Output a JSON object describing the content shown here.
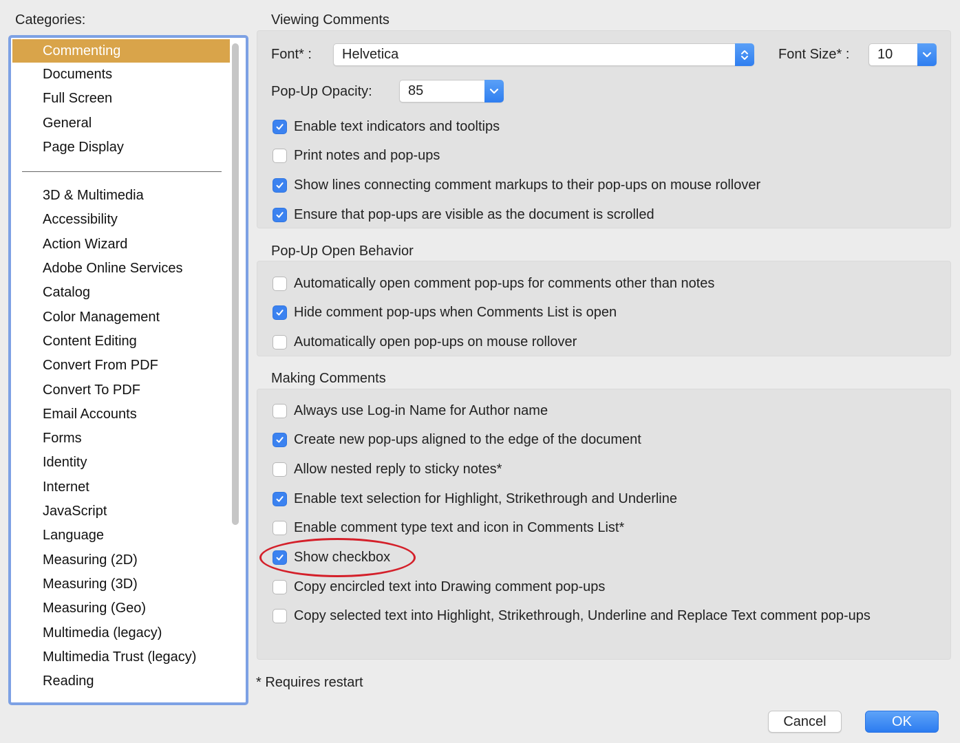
{
  "categories": {
    "title": "Categories:",
    "top_items": [
      {
        "label": "Commenting",
        "selected": true
      },
      {
        "label": "Documents"
      },
      {
        "label": "Full Screen"
      },
      {
        "label": "General"
      },
      {
        "label": "Page Display"
      }
    ],
    "items": [
      "3D & Multimedia",
      "Accessibility",
      "Action Wizard",
      "Adobe Online Services",
      "Catalog",
      "Color Management",
      "Content Editing",
      "Convert From PDF",
      "Convert To PDF",
      "Email Accounts",
      "Forms",
      "Identity",
      "Internet",
      "JavaScript",
      "Language",
      "Measuring (2D)",
      "Measuring (3D)",
      "Measuring (Geo)",
      "Multimedia (legacy)",
      "Multimedia Trust (legacy)",
      "Reading"
    ]
  },
  "viewing": {
    "title": "Viewing Comments",
    "font_label": "Font* :",
    "font_value": "Helvetica",
    "font_size_label": "Font Size* :",
    "font_size_value": "10",
    "opacity_label": "Pop-Up Opacity:",
    "opacity_value": "85",
    "options": [
      {
        "label": "Enable text indicators and tooltips",
        "checked": true
      },
      {
        "label": "Print notes and pop-ups",
        "checked": false
      },
      {
        "label": "Show lines connecting comment markups to their pop-ups on mouse rollover",
        "checked": true
      },
      {
        "label": "Ensure that pop-ups are visible as the document is scrolled",
        "checked": true
      }
    ]
  },
  "popup": {
    "title": "Pop-Up Open Behavior",
    "options": [
      {
        "label": "Automatically open comment pop-ups for comments other than notes",
        "checked": false
      },
      {
        "label": "Hide comment pop-ups when Comments List is open",
        "checked": true
      },
      {
        "label": "Automatically open pop-ups on mouse rollover",
        "checked": false
      }
    ]
  },
  "making": {
    "title": "Making Comments",
    "options": [
      {
        "label": "Always use Log-in Name for Author name",
        "checked": false
      },
      {
        "label": "Create new pop-ups aligned to the edge of the document",
        "checked": true
      },
      {
        "label": "Allow nested reply to sticky notes*",
        "checked": false
      },
      {
        "label": "Enable text selection for Highlight, Strikethrough and Underline",
        "checked": true
      },
      {
        "label": "Enable comment type text and icon in Comments List*",
        "checked": false
      },
      {
        "label": "Show checkbox",
        "checked": true
      },
      {
        "label": "Copy encircled text into Drawing comment pop-ups",
        "checked": false
      },
      {
        "label": "Copy selected text into Highlight, Strikethrough, Underline and Replace Text comment pop-ups",
        "checked": false
      }
    ]
  },
  "footer": {
    "note": "* Requires restart",
    "cancel_label": "Cancel",
    "ok_label": "OK"
  },
  "colors": {
    "selected_category": "#d9a44a",
    "accent": "#3b82f0",
    "annotation": "#d4202a"
  }
}
